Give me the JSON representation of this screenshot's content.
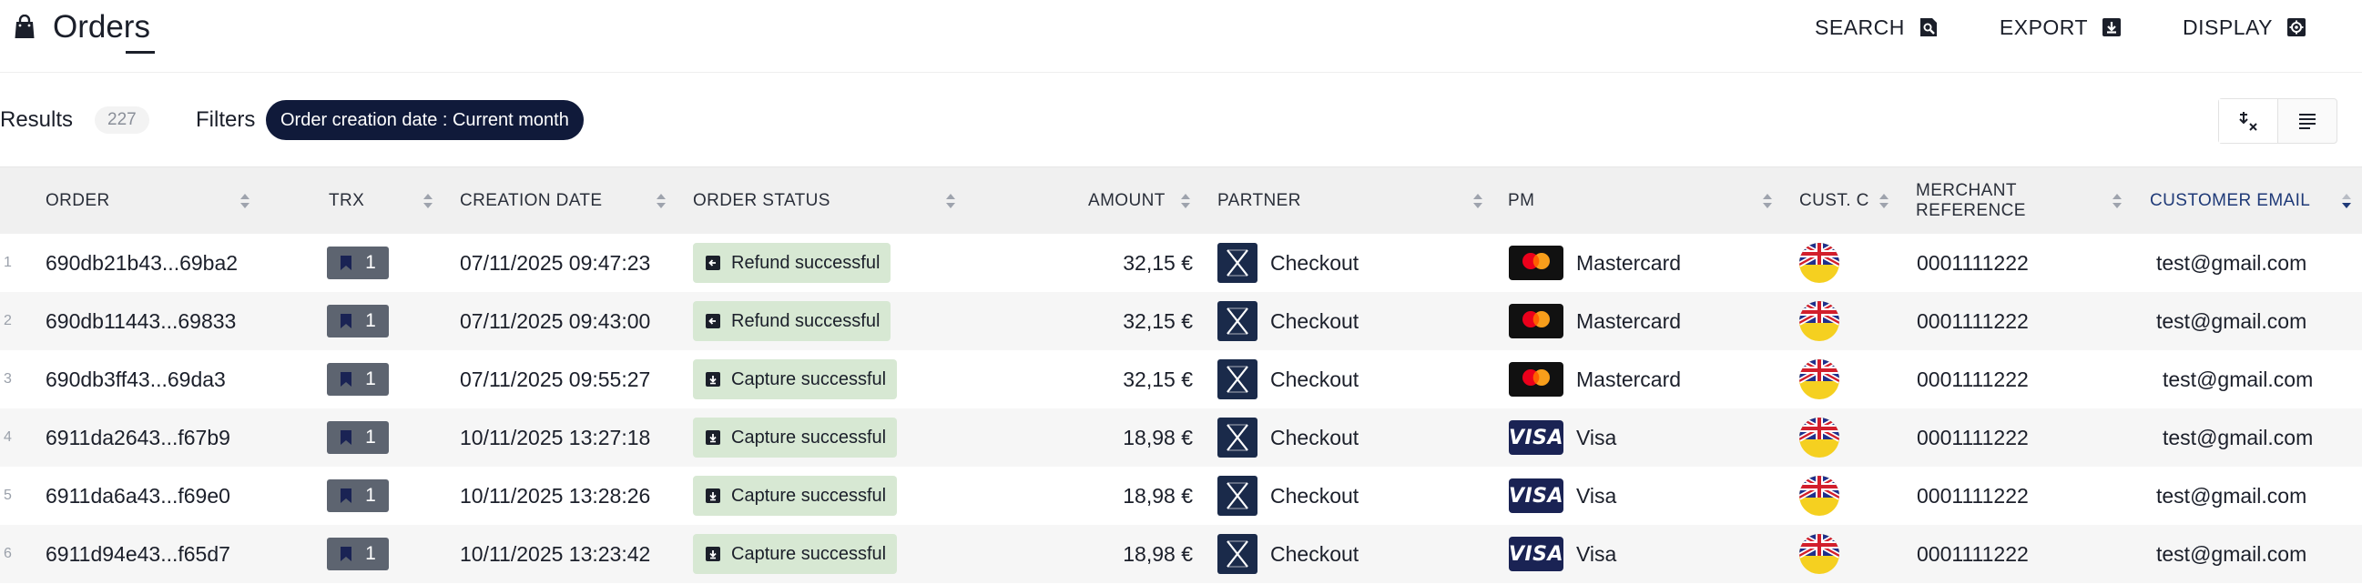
{
  "header": {
    "title": "Orders",
    "actions": [
      {
        "label": "SEARCH",
        "icon": "search-icon"
      },
      {
        "label": "EXPORT",
        "icon": "export-icon"
      },
      {
        "label": "DISPLAY",
        "icon": "display-settings-icon"
      }
    ]
  },
  "filterbar": {
    "results_label": "Results",
    "results_count": "227",
    "filters_label": "Filters",
    "filter_chip": "Order creation date :  Current month"
  },
  "table": {
    "columns": [
      "ORDER",
      "TRX",
      "CREATION DATE",
      "ORDER STATUS",
      "AMOUNT",
      "PARTNER",
      "PM",
      "CUST. C",
      "MERCHANT REFERENCE",
      "CUSTOMER EMAIL"
    ],
    "rows": [
      {
        "num": "1",
        "order": "690db21b43...69ba2",
        "trx": "1",
        "date": "07/11/2025 09:47:23",
        "status": "Refund successful",
        "amount": "32,15 €",
        "partner": "Checkout",
        "pm": "Mastercard",
        "ref": "0001111222",
        "email": "test@gmail.com"
      },
      {
        "num": "2",
        "order": "690db11443...69833",
        "trx": "1",
        "date": "07/11/2025 09:43:00",
        "status": "Refund successful",
        "amount": "32,15 €",
        "partner": "Checkout",
        "pm": "Mastercard",
        "ref": "0001111222",
        "email": "test@gmail.com"
      },
      {
        "num": "3",
        "order": "690db3ff43...69da3",
        "trx": "1",
        "date": "07/11/2025 09:55:27",
        "status": "Capture successful",
        "amount": "32,15 €",
        "partner": "Checkout",
        "pm": "Mastercard",
        "ref": "0001111222",
        "email": "test@gmail.com"
      },
      {
        "num": "4",
        "order": "6911da2643...f67b9",
        "trx": "1",
        "date": "10/11/2025 13:27:18",
        "status": "Capture successful",
        "amount": "18,98 €",
        "partner": "Checkout",
        "pm": "Visa",
        "ref": "0001111222",
        "email": "test@gmail.com"
      },
      {
        "num": "5",
        "order": "6911da6a43...f69e0",
        "trx": "1",
        "date": "10/11/2025 13:28:26",
        "status": "Capture successful",
        "amount": "18,98 €",
        "partner": "Checkout",
        "pm": "Visa",
        "ref": "0001111222",
        "email": "test@gmail.com"
      },
      {
        "num": "6",
        "order": "6911d94e43...f65d7",
        "trx": "1",
        "date": "10/11/2025 13:23:42",
        "status": "Capture successful",
        "amount": "18,98 €",
        "partner": "Checkout",
        "pm": "Visa",
        "ref": "0001111222",
        "email": "test@gmail.com"
      }
    ]
  },
  "colors": {
    "chip_bg": "#101a3a",
    "status_bg": "#d7e8d3",
    "trx_bg": "#5d6470",
    "active_column": "#1f3a78"
  }
}
